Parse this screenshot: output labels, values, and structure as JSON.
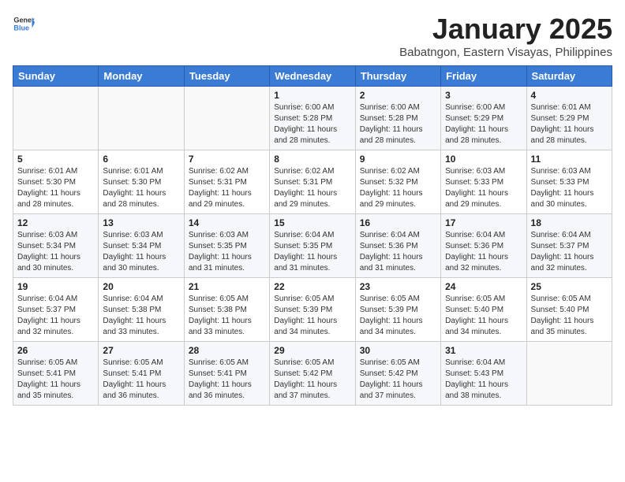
{
  "logo": {
    "text_general": "General",
    "text_blue": "Blue"
  },
  "title": "January 2025",
  "subtitle": "Babatngon, Eastern Visayas, Philippines",
  "weekdays": [
    "Sunday",
    "Monday",
    "Tuesday",
    "Wednesday",
    "Thursday",
    "Friday",
    "Saturday"
  ],
  "weeks": [
    [
      {
        "day": "",
        "info": ""
      },
      {
        "day": "",
        "info": ""
      },
      {
        "day": "",
        "info": ""
      },
      {
        "day": "1",
        "info": "Sunrise: 6:00 AM\nSunset: 5:28 PM\nDaylight: 11 hours\nand 28 minutes."
      },
      {
        "day": "2",
        "info": "Sunrise: 6:00 AM\nSunset: 5:28 PM\nDaylight: 11 hours\nand 28 minutes."
      },
      {
        "day": "3",
        "info": "Sunrise: 6:00 AM\nSunset: 5:29 PM\nDaylight: 11 hours\nand 28 minutes."
      },
      {
        "day": "4",
        "info": "Sunrise: 6:01 AM\nSunset: 5:29 PM\nDaylight: 11 hours\nand 28 minutes."
      }
    ],
    [
      {
        "day": "5",
        "info": "Sunrise: 6:01 AM\nSunset: 5:30 PM\nDaylight: 11 hours\nand 28 minutes."
      },
      {
        "day": "6",
        "info": "Sunrise: 6:01 AM\nSunset: 5:30 PM\nDaylight: 11 hours\nand 28 minutes."
      },
      {
        "day": "7",
        "info": "Sunrise: 6:02 AM\nSunset: 5:31 PM\nDaylight: 11 hours\nand 29 minutes."
      },
      {
        "day": "8",
        "info": "Sunrise: 6:02 AM\nSunset: 5:31 PM\nDaylight: 11 hours\nand 29 minutes."
      },
      {
        "day": "9",
        "info": "Sunrise: 6:02 AM\nSunset: 5:32 PM\nDaylight: 11 hours\nand 29 minutes."
      },
      {
        "day": "10",
        "info": "Sunrise: 6:03 AM\nSunset: 5:33 PM\nDaylight: 11 hours\nand 29 minutes."
      },
      {
        "day": "11",
        "info": "Sunrise: 6:03 AM\nSunset: 5:33 PM\nDaylight: 11 hours\nand 30 minutes."
      }
    ],
    [
      {
        "day": "12",
        "info": "Sunrise: 6:03 AM\nSunset: 5:34 PM\nDaylight: 11 hours\nand 30 minutes."
      },
      {
        "day": "13",
        "info": "Sunrise: 6:03 AM\nSunset: 5:34 PM\nDaylight: 11 hours\nand 30 minutes."
      },
      {
        "day": "14",
        "info": "Sunrise: 6:03 AM\nSunset: 5:35 PM\nDaylight: 11 hours\nand 31 minutes."
      },
      {
        "day": "15",
        "info": "Sunrise: 6:04 AM\nSunset: 5:35 PM\nDaylight: 11 hours\nand 31 minutes."
      },
      {
        "day": "16",
        "info": "Sunrise: 6:04 AM\nSunset: 5:36 PM\nDaylight: 11 hours\nand 31 minutes."
      },
      {
        "day": "17",
        "info": "Sunrise: 6:04 AM\nSunset: 5:36 PM\nDaylight: 11 hours\nand 32 minutes."
      },
      {
        "day": "18",
        "info": "Sunrise: 6:04 AM\nSunset: 5:37 PM\nDaylight: 11 hours\nand 32 minutes."
      }
    ],
    [
      {
        "day": "19",
        "info": "Sunrise: 6:04 AM\nSunset: 5:37 PM\nDaylight: 11 hours\nand 32 minutes."
      },
      {
        "day": "20",
        "info": "Sunrise: 6:04 AM\nSunset: 5:38 PM\nDaylight: 11 hours\nand 33 minutes."
      },
      {
        "day": "21",
        "info": "Sunrise: 6:05 AM\nSunset: 5:38 PM\nDaylight: 11 hours\nand 33 minutes."
      },
      {
        "day": "22",
        "info": "Sunrise: 6:05 AM\nSunset: 5:39 PM\nDaylight: 11 hours\nand 34 minutes."
      },
      {
        "day": "23",
        "info": "Sunrise: 6:05 AM\nSunset: 5:39 PM\nDaylight: 11 hours\nand 34 minutes."
      },
      {
        "day": "24",
        "info": "Sunrise: 6:05 AM\nSunset: 5:40 PM\nDaylight: 11 hours\nand 34 minutes."
      },
      {
        "day": "25",
        "info": "Sunrise: 6:05 AM\nSunset: 5:40 PM\nDaylight: 11 hours\nand 35 minutes."
      }
    ],
    [
      {
        "day": "26",
        "info": "Sunrise: 6:05 AM\nSunset: 5:41 PM\nDaylight: 11 hours\nand 35 minutes."
      },
      {
        "day": "27",
        "info": "Sunrise: 6:05 AM\nSunset: 5:41 PM\nDaylight: 11 hours\nand 36 minutes."
      },
      {
        "day": "28",
        "info": "Sunrise: 6:05 AM\nSunset: 5:41 PM\nDaylight: 11 hours\nand 36 minutes."
      },
      {
        "day": "29",
        "info": "Sunrise: 6:05 AM\nSunset: 5:42 PM\nDaylight: 11 hours\nand 37 minutes."
      },
      {
        "day": "30",
        "info": "Sunrise: 6:05 AM\nSunset: 5:42 PM\nDaylight: 11 hours\nand 37 minutes."
      },
      {
        "day": "31",
        "info": "Sunrise: 6:04 AM\nSunset: 5:43 PM\nDaylight: 11 hours\nand 38 minutes."
      },
      {
        "day": "",
        "info": ""
      }
    ]
  ]
}
